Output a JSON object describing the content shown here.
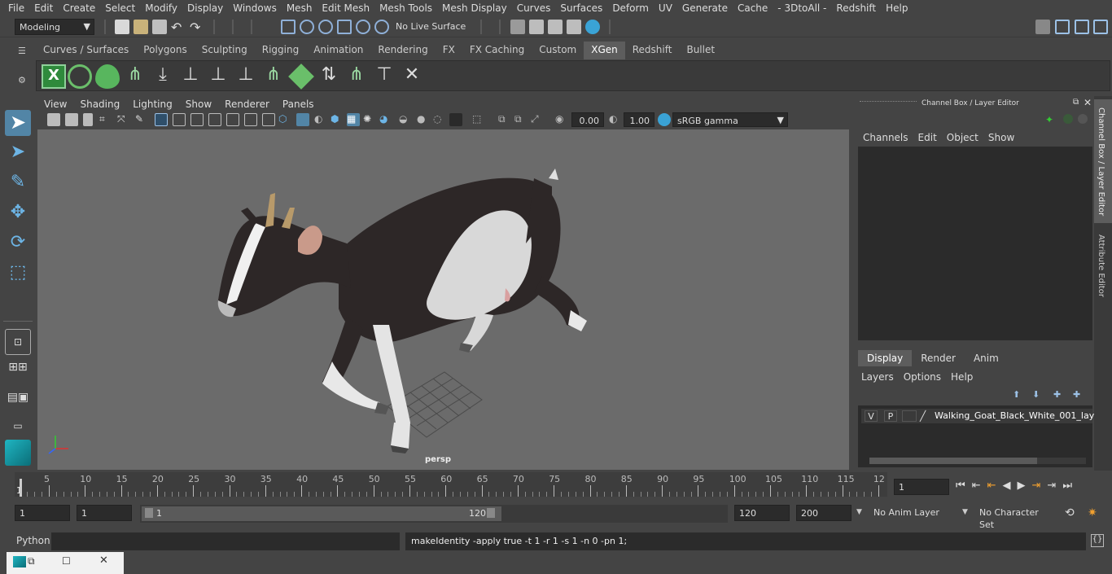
{
  "menubar": [
    "File",
    "Edit",
    "Create",
    "Select",
    "Modify",
    "Display",
    "Windows",
    "Mesh",
    "Edit Mesh",
    "Mesh Tools",
    "Mesh Display",
    "Curves",
    "Surfaces",
    "Deform",
    "UV",
    "Generate",
    "Cache",
    "- 3DtoAll -",
    "Redshift",
    "Help"
  ],
  "status": {
    "mode": "Modeling",
    "live_surface": "No Live Surface"
  },
  "shelf_tabs": [
    "Curves / Surfaces",
    "Polygons",
    "Sculpting",
    "Rigging",
    "Animation",
    "Rendering",
    "FX",
    "FX Caching",
    "Custom",
    "XGen",
    "Redshift",
    "Bullet"
  ],
  "shelf_active": "XGen",
  "viewport": {
    "menu": [
      "View",
      "Shading",
      "Lighting",
      "Show",
      "Renderer",
      "Panels"
    ],
    "exposure": "0.00",
    "gamma": "1.00",
    "colorspace": "sRGB gamma",
    "camera": "persp"
  },
  "channel_box": {
    "title": "Channel Box / Layer Editor",
    "menu": [
      "Channels",
      "Edit",
      "Object",
      "Show"
    ],
    "layer_tabs": [
      "Display",
      "Render",
      "Anim"
    ],
    "layer_menu": [
      "Layers",
      "Options",
      "Help"
    ],
    "layer": {
      "v": "V",
      "p": "P",
      "name": "Walking_Goat_Black_White_001_laye"
    }
  },
  "side_tabs": [
    "Channel Box / Layer Editor",
    "Attribute Editor"
  ],
  "timeline": {
    "ticks": [
      "5",
      "10",
      "15",
      "20",
      "25",
      "30",
      "35",
      "40",
      "45",
      "50",
      "55",
      "60",
      "65",
      "70",
      "75",
      "80",
      "85",
      "90",
      "95",
      "100",
      "105",
      "110",
      "115",
      "12"
    ],
    "start_label": "1",
    "current_frame": "1"
  },
  "range": {
    "start": "1",
    "playback_start": "1",
    "slider_start": "1",
    "slider_end": "120",
    "playback_end": "120",
    "end": "200",
    "anim_layer": "No Anim Layer",
    "char_set": "No Character Set"
  },
  "command": {
    "lang": "Python",
    "output": "makeIdentity -apply true -t 1 -r 1 -s 1 -n 0 -pn 1;"
  },
  "colors": {
    "bg": "#444444",
    "viewport": "#6b6b6b",
    "accent": "#5d5d5d",
    "select": "#5285a6"
  }
}
